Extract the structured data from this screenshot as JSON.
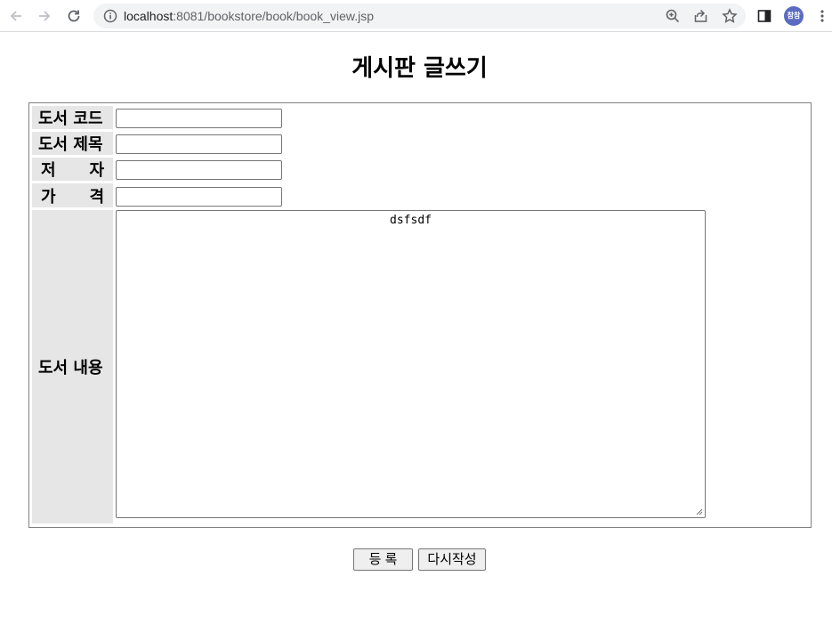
{
  "browser": {
    "url_host": "localhost",
    "url_rest": ":8081/bookstore/book/book_view.jsp",
    "avatar_text": "참참"
  },
  "page": {
    "title": "게시판 글쓰기"
  },
  "form": {
    "code_label": "도서 코드",
    "title_label": "도서 제목",
    "author_label_1": "저",
    "author_label_2": "자",
    "price_label_1": "가",
    "price_label_2": "격",
    "content_label": "도서 내용",
    "code_value": "",
    "title_value": "",
    "author_value": "",
    "price_value": "",
    "content_value": "dsfsdf"
  },
  "buttons": {
    "submit": "등  록",
    "reset": "다시작성"
  }
}
